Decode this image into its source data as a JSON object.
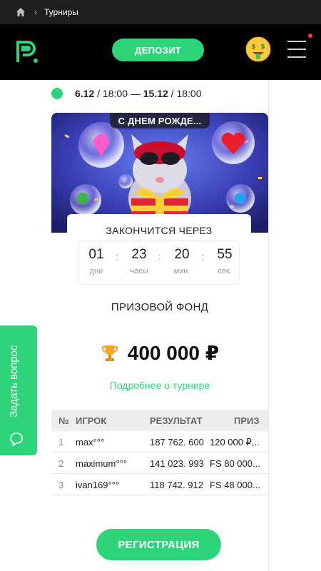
{
  "breadcrumb": {
    "current": "Турниры"
  },
  "header": {
    "deposit_label": "ДЕПОЗИТ"
  },
  "tournament": {
    "date_start": "6.12",
    "time_start": "/ 18:00 —",
    "date_end": "15.12",
    "time_end": "/ 18:00",
    "banner_title": "С ДНЕМ РОЖДЕ...",
    "timer_title": "ЗАКОНЧИТСЯ ЧЕРЕЗ",
    "timer": [
      {
        "value": "01",
        "label": "дни"
      },
      {
        "value": "23",
        "label": "часы"
      },
      {
        "value": "20",
        "label": "мин."
      },
      {
        "value": "55",
        "label": "сек."
      }
    ],
    "prize_label": "ПРИЗОВОЙ ФОНД",
    "prize_amount": "400 000 ₽",
    "more_link": "Подробнее о турнире",
    "register_label": "РЕГИСТРАЦИЯ"
  },
  "leaderboard": {
    "headers": {
      "rank": "№",
      "player": "ИГРОК",
      "result": "РЕЗУЛЬТАТ",
      "prize": "ПРИЗ"
    },
    "rows": [
      {
        "rank": "1",
        "player": "max°°°",
        "result": "187 762. 600",
        "prize": "120 000 ₽,.."
      },
      {
        "rank": "2",
        "player": "maximum°°°",
        "result": "141 023. 993",
        "prize": "FS 80 000..."
      },
      {
        "rank": "3",
        "player": "ivan169°°°",
        "result": "118 742. 912",
        "prize": "FS 48 000..."
      }
    ]
  },
  "side_tab": {
    "label": "Задать вопрос"
  },
  "colors": {
    "accent": "#2ed47a",
    "header_bg": "#000000",
    "notification": "#ff3b4f"
  },
  "icons": [
    "home-icon",
    "chevron-right-icon",
    "brand-logo",
    "money-face-emoji-icon",
    "hamburger-menu-icon",
    "trophy-icon",
    "chat-bubble-icon"
  ]
}
